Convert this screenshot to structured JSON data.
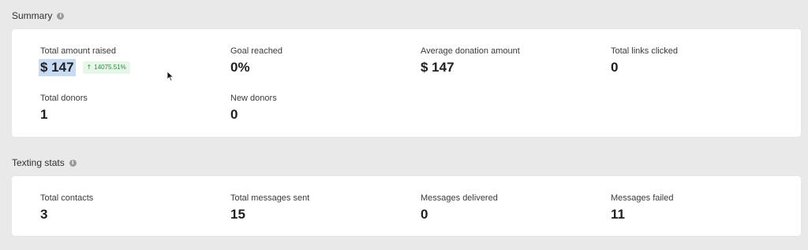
{
  "summary": {
    "title": "Summary",
    "info_icon": "info-icon",
    "stats": {
      "total_amount_raised": {
        "label": "Total amount raised",
        "value": "$ 147",
        "change": "14075.51%",
        "change_icon": "arrow-up-icon",
        "change_color": "#2e8b3e"
      },
      "goal_reached": {
        "label": "Goal reached",
        "value": "0%"
      },
      "average_donation": {
        "label": "Average donation amount",
        "value": "$ 147"
      },
      "total_links_clicked": {
        "label": "Total links clicked",
        "value": "0"
      },
      "total_donors": {
        "label": "Total donors",
        "value": "1"
      },
      "new_donors": {
        "label": "New donors",
        "value": "0"
      }
    }
  },
  "texting_stats": {
    "title": "Texting stats",
    "info_icon": "info-icon",
    "stats": {
      "total_contacts": {
        "label": "Total contacts",
        "value": "3"
      },
      "total_messages_sent": {
        "label": "Total messages sent",
        "value": "15"
      },
      "messages_delivered": {
        "label": "Messages delivered",
        "value": "0"
      },
      "messages_failed": {
        "label": "Messages failed",
        "value": "11"
      }
    }
  },
  "colors": {
    "page_background": "#e9e9e9",
    "card_background": "#ffffff",
    "selection_highlight": "#c7dcf4",
    "badge_background": "#e7f6e9"
  }
}
